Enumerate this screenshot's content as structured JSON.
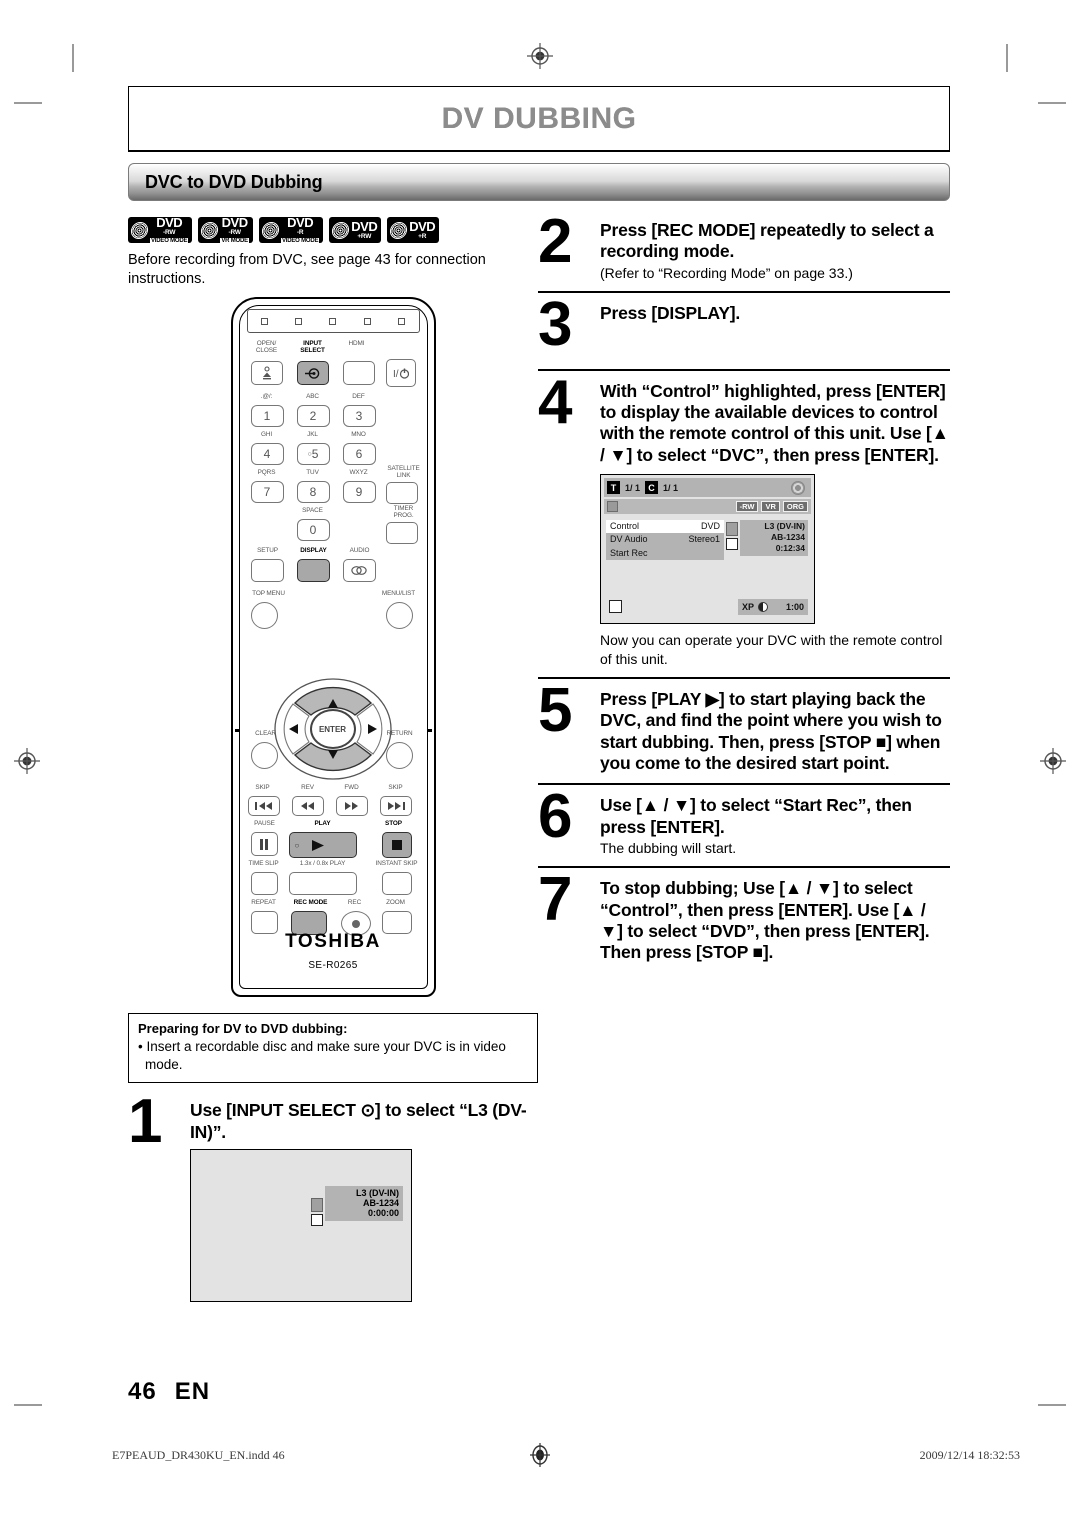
{
  "chapter": {
    "title": "DV DUBBING"
  },
  "section": {
    "title": "DVC to DVD Dubbing"
  },
  "badges": [
    {
      "main": "DVD",
      "sub": "-RW",
      "sub2": "VIDEO MODE"
    },
    {
      "main": "DVD",
      "sub": "-RW",
      "sub2": "VR MODE"
    },
    {
      "main": "DVD",
      "sub": "-R",
      "sub2": "VIDEO MODE"
    },
    {
      "main": "DVD",
      "sub": "+RW",
      "sub2": ""
    },
    {
      "main": "DVD",
      "sub": "+R",
      "sub2": ""
    }
  ],
  "intro": "Before recording from DVC, see page 43 for connection instructions.",
  "remote": {
    "brand": "TOSHIBA",
    "model": "SE-R0265",
    "labels": {
      "open_close": "OPEN/\nCLOSE",
      "input_select": "INPUT\nSELECT",
      "hdmi": "HDMI",
      "power": "I/⏻",
      "k1_abc": ".@/:",
      "k2_abc": "ABC",
      "k3_def": "DEF",
      "k4_ghi": "GHI",
      "k5_jkl": "JKL",
      "k6_mno": "MNO",
      "k7_pqrs": "PQRS",
      "k8_tuv": "TUV",
      "k9_wxyz": "WXYZ",
      "k0_space": "SPACE",
      "satellite_link": "SATELLITE\nLINK",
      "timer_prog": "TIMER\nPROG.",
      "setup": "SETUP",
      "display": "DISPLAY",
      "audio": "AUDIO",
      "top_menu": "TOP MENU",
      "menu_list": "MENU/LIST",
      "clear": "CLEAR",
      "return": "RETURN",
      "enter": "ENTER",
      "skip_back": "SKIP",
      "rev": "REV",
      "fwd": "FWD",
      "skip_fwd": "SKIP",
      "pause": "PAUSE",
      "play": "PLAY",
      "stop": "STOP",
      "time_slip": "TIME SLIP",
      "speed_play": "1.3x / 0.8x PLAY",
      "instant_skip": "INSTANT SKIP",
      "repeat": "REPEAT",
      "rec_mode": "REC MODE",
      "rec": "REC",
      "zoom": "ZOOM"
    },
    "numbers": [
      "1",
      "2",
      "3",
      "4",
      "5",
      "6",
      "7",
      "8",
      "9",
      "0"
    ]
  },
  "prep": {
    "title": "Preparing for DV to DVD dubbing:",
    "item": "• Insert a recordable disc and make sure your DVC is in video mode."
  },
  "steps": [
    {
      "num": "1",
      "head": "Use [INPUT SELECT ⊙] to select “L3 (DV-IN)”.",
      "sub": ""
    },
    {
      "num": "2",
      "head": "Press [REC MODE] repeatedly to select a recording mode.",
      "sub": "(Refer to “Recording Mode” on page 33.)"
    },
    {
      "num": "3",
      "head": "Press [DISPLAY].",
      "sub": ""
    },
    {
      "num": "4",
      "head": "With “Control” highlighted, press [ENTER] to display the available devices to control with the remote control of this unit. Use [▲ / ▼] to select “DVC”, then press [ENTER].",
      "sub": ""
    },
    {
      "num": "5",
      "head": "Press [PLAY ▶] to start playing back the DVC, and find the point where you wish to start dubbing. Then, press [STOP ■] when you come to the desired start point.",
      "sub": ""
    },
    {
      "num": "6",
      "head": "Use [▲ / ▼] to select “Start Rec”, then press [ENTER].",
      "sub": "The dubbing will start."
    },
    {
      "num": "7",
      "head": "To stop dubbing; Use [▲ / ▼] to select “Control”, then press [ENTER]. Use [▲ / ▼] to select “DVD”, then press [ENTER]. Then press [STOP ■].",
      "sub": ""
    }
  ],
  "step4_note": "Now you can operate your DVC with the remote control of this unit.",
  "osd_step4": {
    "title_chip": "T",
    "title_num": "1/  1",
    "chapter_chip": "C",
    "chapter_num": "1/  1",
    "tags": [
      "-RW",
      "VR",
      "ORG"
    ],
    "menu": [
      {
        "label": "Control",
        "value": "DVD",
        "selected": true
      },
      {
        "label": "DV Audio",
        "value": "Stereo1",
        "selected": false
      },
      {
        "label": "Start Rec",
        "value": "",
        "selected": false
      }
    ],
    "info": {
      "input": "L3 (DV-IN)",
      "tape": "AB-1234",
      "time": "0:12:34"
    },
    "bottom": {
      "mode": "XP",
      "remaining": "1:00"
    }
  },
  "osd_step1": {
    "input": "L3 (DV-IN)",
    "tape": "AB-1234",
    "time": "0:00:00"
  },
  "page": {
    "number": "46",
    "lang": "EN"
  },
  "footer": {
    "file": "E7PEAUD_DR430KU_EN.indd   46",
    "timestamp": "2009/12/14   18:32:53"
  }
}
